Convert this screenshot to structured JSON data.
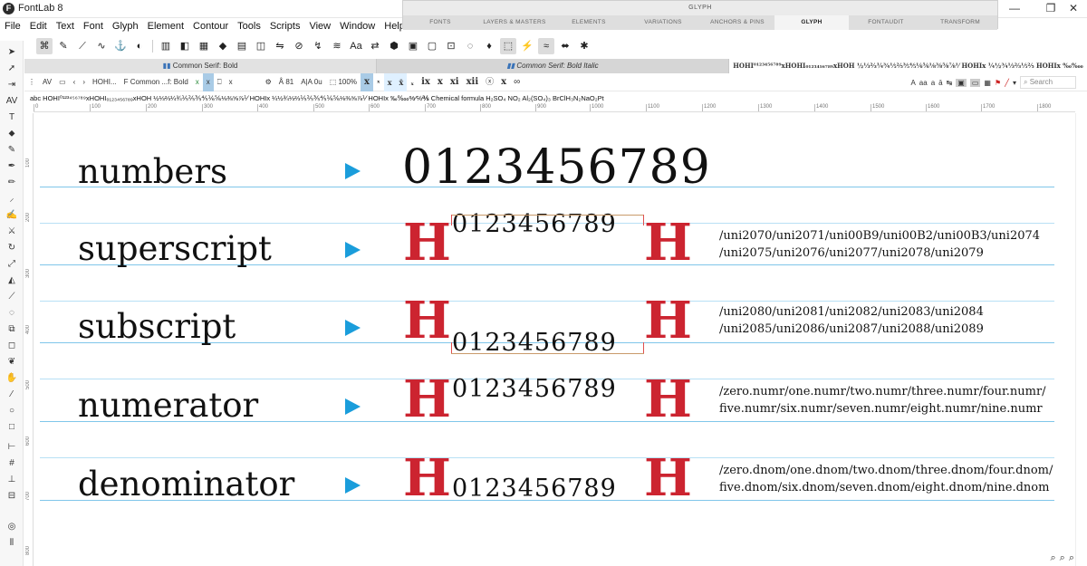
{
  "window": {
    "title": "FontLab 8",
    "logo": "F",
    "minimize": "—",
    "maximize": "❐",
    "close": "✕"
  },
  "menu": [
    "File",
    "Edit",
    "Text",
    "Font",
    "Glyph",
    "Element",
    "Contour",
    "Tools",
    "Scripts",
    "View",
    "Window",
    "Help"
  ],
  "panel": {
    "title": "GLYPH",
    "tabs": [
      "FONTS",
      "LAYERS & MASTERS",
      "ELEMENTS",
      "VARIATIONS",
      "ANCHORS & PINS",
      "GLYPH",
      "FONTAUDIT",
      "TRANSFORM"
    ],
    "active_tab": "GLYPH"
  },
  "tabs": {
    "active": "Common Serif: Bold",
    "inactive": "Common Serif: Bold Italic",
    "preview": "HOHI⁰¹²³⁴⁵⁶⁷⁸⁹xHOHI₀₁₂₃₄₅₆₇₈₉xHOH ½⅓⅔¼¾⅕⅖⅗⅘⅙⅚⅛⅜⅝⅞⅟ HOHIx ¼½¾⅓⅔⅕⅖ HOHIx ‰‱"
  },
  "texttoolbar": {
    "text_sample": "HOHI...",
    "font_name": "Common ...f: Bold",
    "glyph_x": "x",
    "glyph_highlight": "x",
    "glyph_field": "x",
    "size": "81",
    "kern": "0u",
    "zoom": "100%",
    "glyph_variants": [
      "x",
      "ˣ",
      "x",
      "x̄",
      "ₓ",
      "ix",
      "x",
      "xi",
      "xii",
      "ⓧ",
      "x",
      "∞"
    ],
    "search_placeholder": "Search"
  },
  "string": "abc  HOHI⁰¹²³⁴⁵⁶⁷⁸⁹xHOHI₀₁₂₃₄₅₆₇₈₉xHOH ½⅓⅔¼¾⅕⅖⅗⅘⅙⅚⅛⅜⅝⅞⅟ HOHIx ¼½¾⅓⅔⅕⅖⅗⅘⅙⅚⅛⅜⅝⅞⅟ HOHIx ‰‱%⁄℅℁ Chemical formula H₂SO₄ NO₂ Al₂(SO₄)₃ BrClH₃N₂NaO₂Pt",
  "ruler": {
    "h": [
      "0",
      "100",
      "200",
      "300",
      "400",
      "500",
      "600",
      "700",
      "800",
      "900",
      "1000",
      "1100",
      "1200",
      "1300",
      "1400",
      "1500",
      "1600",
      "1700",
      "1800"
    ],
    "v": [
      "100",
      "200",
      "300",
      "400",
      "500",
      "600",
      "700",
      "800"
    ]
  },
  "rows": [
    {
      "label": "numbers",
      "digits": "0123456789",
      "names": []
    },
    {
      "label": "superscript",
      "digits": "0123456789",
      "H": "H",
      "names": [
        "/uni2070/uni2071/uni00B9/uni00B2/uni00B3/uni2074",
        "/uni2075/uni2076/uni2077/uni2078/uni2079"
      ]
    },
    {
      "label": "subscript",
      "digits": "0123456789",
      "H": "H",
      "names": [
        "/uni2080/uni2081/uni2082/uni2083/uni2084",
        "/uni2085/uni2086/uni2087/uni2088/uni2089"
      ]
    },
    {
      "label": "numerator",
      "digits": "0123456789",
      "H": "H",
      "names": [
        "/zero.numr/one.numr/two.numr/three.numr/four.numr/",
        "five.numr/six.numr/seven.numr/eight.numr/nine.numr"
      ]
    },
    {
      "label": "denominator",
      "digits": "0123456789",
      "H": "H",
      "names": [
        "/zero.dnom/one.dnom/two.dnom/three.dnom/four.dnom/",
        "five.dnom/six.dnom/seven.dnom/eight.dnom/nine.dnom"
      ]
    }
  ],
  "colors": {
    "accent_H": "#cc2430",
    "arrow": "#1a9ddb",
    "baseline": "#7fc6ea"
  }
}
